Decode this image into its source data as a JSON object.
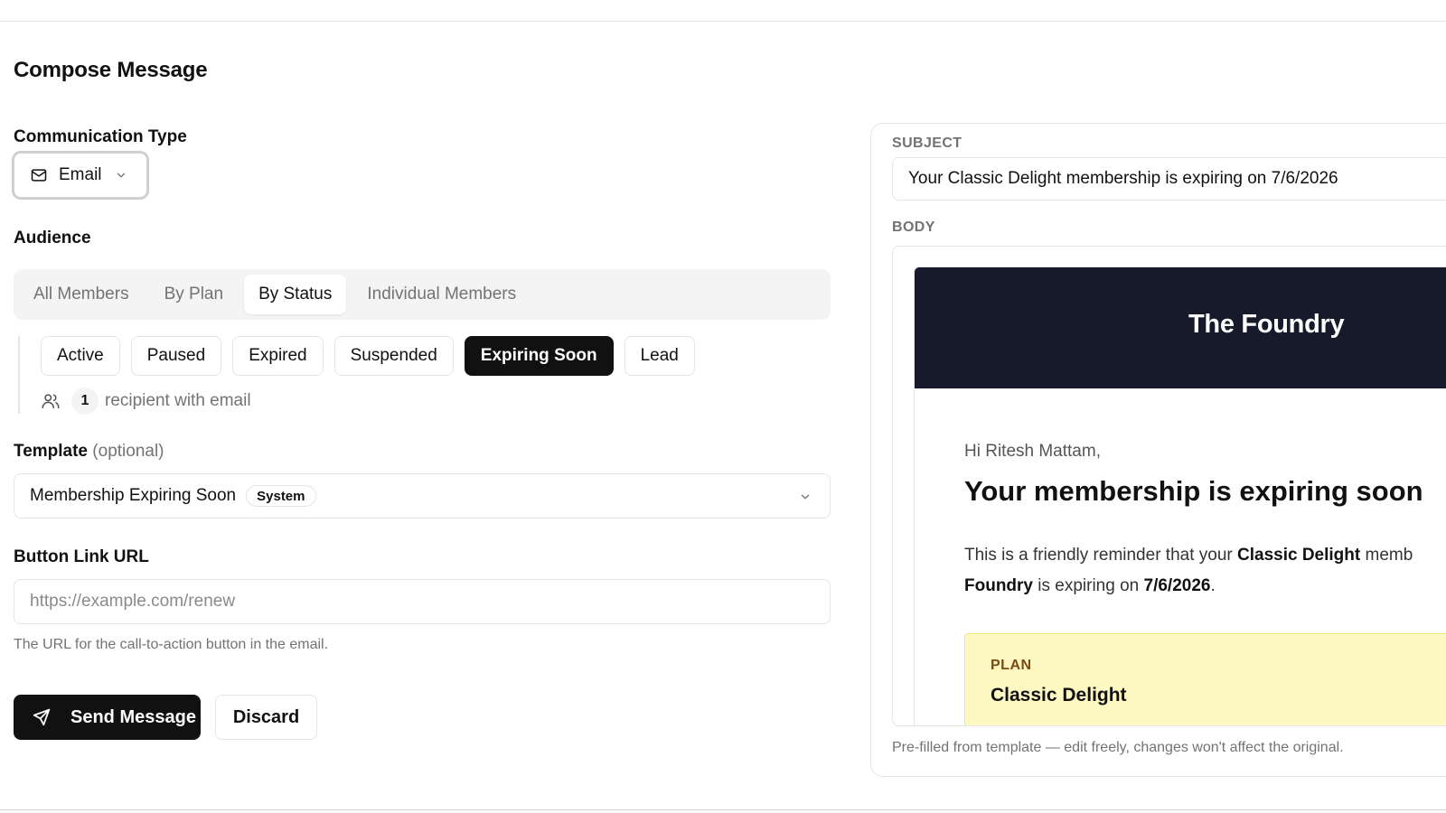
{
  "page": {
    "title": "Compose Message"
  },
  "communication_type": {
    "label": "Communication Type",
    "value": "Email",
    "icon": "mail-icon"
  },
  "audience": {
    "label": "Audience",
    "tabs": [
      {
        "label": "All Members",
        "active": false
      },
      {
        "label": "By Plan",
        "active": false
      },
      {
        "label": "By Status",
        "active": true
      },
      {
        "label": "Individual Members",
        "active": false
      }
    ],
    "statuses": [
      {
        "label": "Active",
        "selected": false
      },
      {
        "label": "Paused",
        "selected": false
      },
      {
        "label": "Expired",
        "selected": false
      },
      {
        "label": "Suspended",
        "selected": false
      },
      {
        "label": "Expiring Soon",
        "selected": true
      },
      {
        "label": "Lead",
        "selected": false
      }
    ],
    "recipient_count": "1",
    "recipient_text": "recipient with email"
  },
  "template": {
    "label": "Template",
    "optional": "(optional)",
    "value": "Membership Expiring Soon",
    "badge": "System"
  },
  "button_link": {
    "label": "Button Link URL",
    "placeholder": "https://example.com/renew",
    "help": "The URL for the call-to-action button in the email."
  },
  "actions": {
    "send_label": "Send Message",
    "discard_label": "Discard"
  },
  "preview": {
    "subject_label": "SUBJECT",
    "subject_value": "Your Classic Delight membership is expiring on 7/6/2026",
    "body_label": "BODY",
    "email": {
      "brand": "The Foundry",
      "greeting": "Hi Ritesh Mattam,",
      "heading": "Your membership is expiring soon",
      "para_1": "This is a friendly reminder that your ",
      "para_plan": "Classic Delight",
      "para_2": " memb",
      "para_brand": "Foundry",
      "para_3": " is expiring on ",
      "para_date": "7/6/2026",
      "para_4": ".",
      "plan_label": "PLAN",
      "plan_name": "Classic Delight"
    },
    "note": "Pre-filled from template — edit freely, changes won't affect the original."
  },
  "colors": {
    "primary": "#111111",
    "email_header": "#171a2b",
    "plan_box": "#fef9c3",
    "muted_text": "#737373"
  }
}
